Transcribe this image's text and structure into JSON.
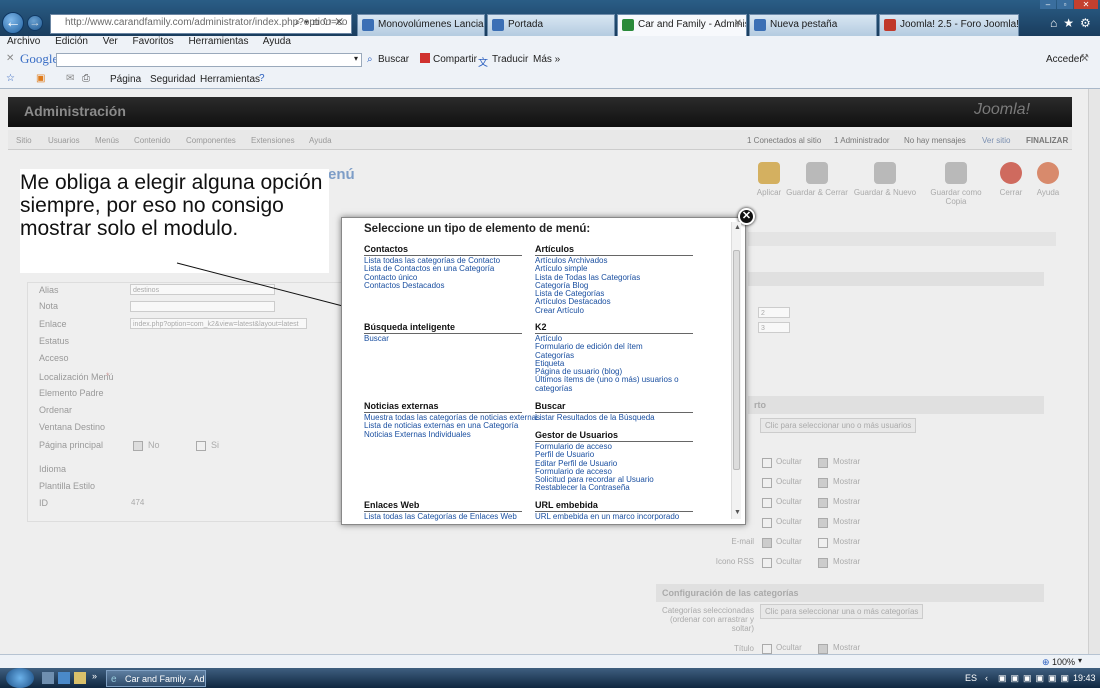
{
  "browser": {
    "address": "http://www.carandfamily.com/administrator/index.php?option=co",
    "tabs": [
      {
        "label": "Monovolúmenes Lancia. Coch...",
        "color": "#3b6fb5"
      },
      {
        "label": "Portada",
        "color": "#3b6fb5"
      },
      {
        "label": "Car and Family - Administ...",
        "color": "#2a8a3a"
      },
      {
        "label": "Nueva pestaña",
        "color": "#3b6fb5"
      },
      {
        "label": "Joomla! 2.5 - Foro Joomla! - Se...",
        "color": "#c0392b"
      }
    ],
    "menu": [
      "Archivo",
      "Edición",
      "Ver",
      "Favoritos",
      "Herramientas",
      "Ayuda"
    ],
    "google": {
      "logo": "Google",
      "buscar": "Buscar",
      "compartir": "Compartir",
      "traducir": "Traducir",
      "mas": "Más »",
      "acceder": "Acceder"
    },
    "cmd": {
      "pagina": "Página",
      "seguridad": "Seguridad",
      "herramientas": "Herramientas"
    },
    "status": {
      "zoom": "100%"
    }
  },
  "joomla": {
    "title": "Administración",
    "logo": "Joomla!",
    "submenu": [
      "Sitio",
      "Usuarios",
      "Menús",
      "Contenido",
      "Componentes",
      "Extensiones",
      "Ayuda"
    ],
    "status_items": [
      "1 Conectados al sitio",
      "1 Administrador",
      "No hay mensajes",
      "Ver sitio",
      "FINALIZAR"
    ],
    "page_title_fragment": "enú",
    "toolbar": [
      "Aplicar",
      "Guardar & Cerrar",
      "Guardar & Nuevo",
      "Guardar como Copia",
      "Cerrar",
      "Ayuda"
    ],
    "fields": [
      {
        "label": "Alias",
        "value": "destinos"
      },
      {
        "label": "Nota",
        "value": ""
      },
      {
        "label": "Enlace",
        "value": "index.php?option=com_k2&view=latest&layout=latest"
      },
      {
        "label": "Estatus",
        "value": ""
      },
      {
        "label": "Acceso",
        "value": ""
      },
      {
        "label": "Localización Menú",
        "value": ""
      },
      {
        "label": "Elemento Padre",
        "value": ""
      },
      {
        "label": "Ordenar",
        "value": ""
      },
      {
        "label": "Ventana Destino",
        "value": ""
      },
      {
        "label": "Página principal",
        "value": ""
      },
      {
        "label": "Idioma",
        "value": ""
      },
      {
        "label": "Plantilla Estilo",
        "value": ""
      },
      {
        "label": "ID",
        "value": "474"
      }
    ],
    "localizacion_star": "*",
    "home_no": "No",
    "home_si": "Si",
    "right": {
      "value_2": "2",
      "value_3": "3",
      "panel_fragment": "rto",
      "select_users_btn": "Clic para seleccionar uno o más usuarios",
      "ocultar": "Ocultar",
      "mostrar": "Mostrar",
      "email_label": "E-mail",
      "rss_label": "Icono RSS",
      "cat_panel": "Configuración de las categorías",
      "cat_label": "Categorías seleccionadas (ordenar con arrastrar y soltar)",
      "cat_btn": "Clic para seleccionar una o más categorías",
      "titulo_label": "Título"
    }
  },
  "callout": {
    "text": "Me obliga a elegir alguna opción siempre, por eso no consigo mostrar solo el modulo."
  },
  "modal": {
    "title": "Seleccione un tipo de elemento de menú:",
    "left": [
      {
        "heading": "Contactos",
        "items": [
          "Lista todas las categorías de Contacto",
          "Lista de Contactos en una Categoría",
          "Contacto único",
          "Contactos Destacados"
        ]
      },
      {
        "heading": "Búsqueda inteligente",
        "items": [
          "Buscar"
        ]
      },
      {
        "heading": "Noticias externas",
        "items": [
          "Muestra todas las categorías de noticias externas",
          "Lista de noticias externas en una Categoría",
          "Noticias Externas Individuales"
        ]
      },
      {
        "heading": "Enlaces Web",
        "items": [
          "Lista todas las Categorías de Enlaces Web"
        ]
      }
    ],
    "right": [
      {
        "heading": "Artículos",
        "items": [
          "Artículos Archivados",
          "Artículo simple",
          "Lista de Todas las Categorías",
          "Categoría Blog",
          "Lista de Categorías",
          "Artículos Destacados",
          "Crear Artículo"
        ]
      },
      {
        "heading": "K2",
        "items": [
          "Artículo",
          "Formulario de edición del ítem",
          "Categorías",
          "Etiqueta",
          "Página de usuario (blog)",
          "Últimos ítems de (uno o más) usuarios o",
          "categorías"
        ]
      },
      {
        "heading": "Buscar",
        "items": [
          "Listar Resultados de la Búsqueda"
        ]
      },
      {
        "heading": "Gestor de Usuarios",
        "items": [
          "Formulario de acceso",
          "Perfil de Usuario",
          "Editar Perfil de Usuario",
          "Formulario de acceso",
          "Solicitud para recordar al Usuario",
          "Restablecer la Contraseña"
        ]
      },
      {
        "heading": "URL embebida",
        "items": [
          "URL embebida en un marco incorporado"
        ]
      }
    ]
  },
  "taskbar": {
    "item": "Car and Family - Ad...",
    "lang": "ES",
    "clock": "19:43"
  }
}
